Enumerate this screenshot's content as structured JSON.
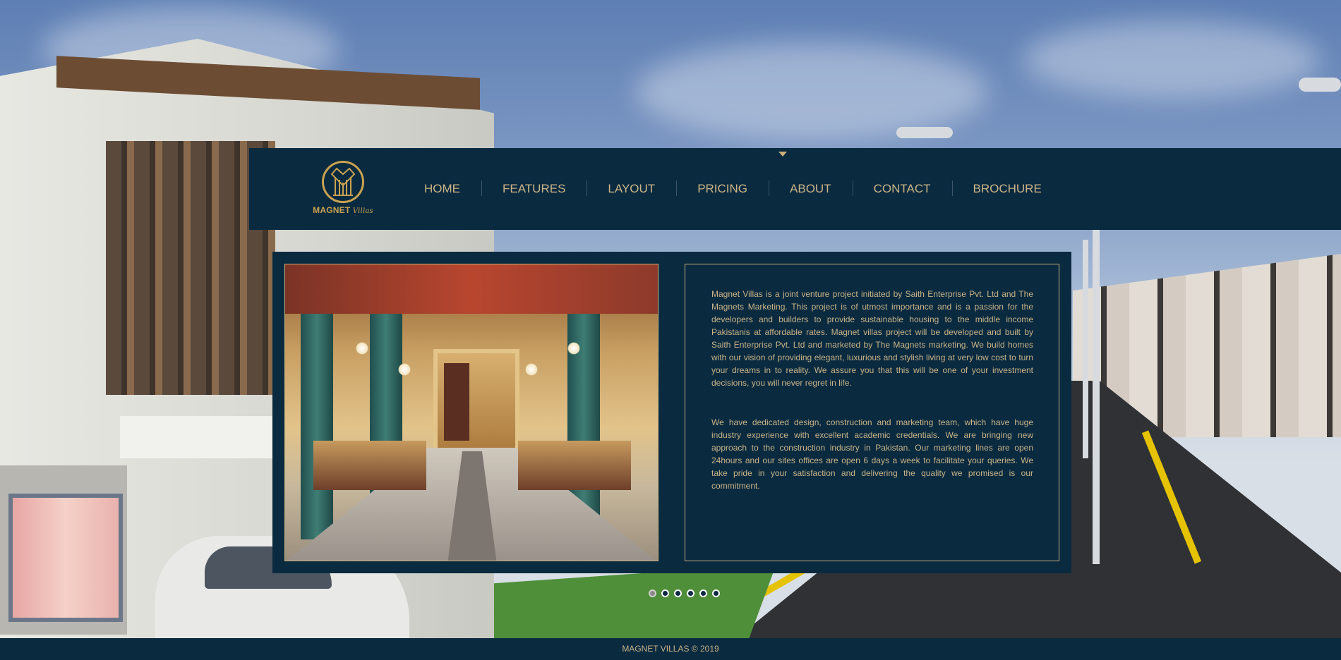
{
  "brand": {
    "name": "MAGNET",
    "tagline": "Villas",
    "gold": "#c9a24f",
    "navy": "#0a2a40"
  },
  "nav": {
    "items": [
      {
        "label": "HOME"
      },
      {
        "label": "FEATURES"
      },
      {
        "label": "LAYOUT"
      },
      {
        "label": "PRICING"
      },
      {
        "label": "ABOUT"
      },
      {
        "label": "CONTACT"
      },
      {
        "label": "BROCHURE"
      }
    ]
  },
  "about": {
    "paragraph_1": "Magnet Villas is a joint venture project initiated by Saith Enterprise Pvt. Ltd and The Magnets Marketing. This project is of utmost importance and is a passion for the developers and builders to provide sustainable housing to the middle income Pakistanis at affordable rates. Magnet villas project will be developed and built by Saith Enterprise Pvt. Ltd and marketed by The Magnets marketing. We build homes with our vision of providing elegant, luxurious and stylish living at very low cost to turn your dreams in to reality. We assure you that this will be one of your investment decisions, you will never regret in life.",
    "paragraph_2": "We have dedicated design, construction and marketing team, which have huge industry experience with excellent academic credentials. We are bringing new approach to the construction industry in Pakistan. Our marketing lines are open 24hours and our sites offices are open 6 days a week to facilitate your queries. We take pride in your satisfaction and delivering the quality we promised is our commitment."
  },
  "slider": {
    "count": 6,
    "active_index": 0
  },
  "footer": {
    "text": "MAGNET VILLAS © 2019"
  }
}
